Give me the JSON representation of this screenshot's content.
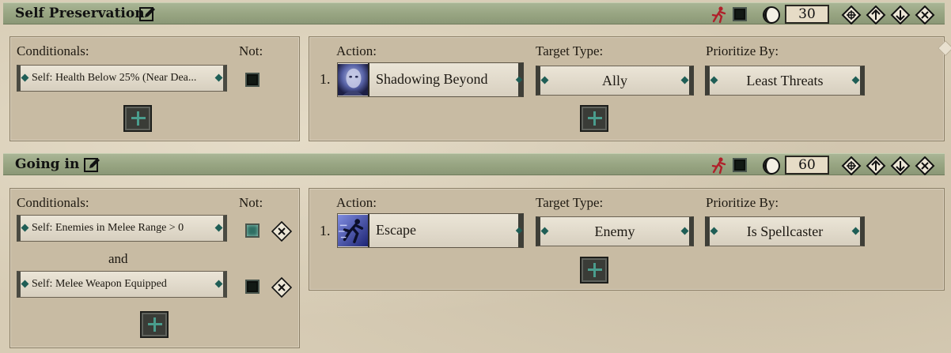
{
  "rules": [
    {
      "title": "Self Preservation",
      "priority": "30",
      "conditionals_label": "Conditionals:",
      "not_label": "Not:",
      "conditions": [
        {
          "text": "Self: Health Below 25% (Near Dea...",
          "not": false
        }
      ],
      "action_label": "Action:",
      "target_label": "Target Type:",
      "prioritize_label": "Prioritize By:",
      "action": {
        "index": "1.",
        "name": "Shadowing Beyond",
        "icon": "shadow-portrait-icon"
      },
      "target_type": "Ally",
      "prioritize_by": "Least Threats"
    },
    {
      "title": "Going in",
      "priority": "60",
      "conditionals_label": "Conditionals:",
      "not_label": "Not:",
      "and_label": "and",
      "conditions": [
        {
          "text": "Self: Enemies in Melee Range > 0",
          "not": true
        },
        {
          "text": "Self: Melee Weapon Equipped",
          "not": false
        }
      ],
      "action_label": "Action:",
      "target_label": "Target Type:",
      "prioritize_label": "Prioritize By:",
      "action": {
        "index": "1.",
        "name": "Escape",
        "icon": "running-figure-icon"
      },
      "target_type": "Enemy",
      "prioritize_by": "Is Spellcaster"
    }
  ],
  "colors": {
    "header": "#97a481",
    "panel": "#c8bba3",
    "accent": "#1f5e56",
    "run_icon": "#b0202a"
  }
}
